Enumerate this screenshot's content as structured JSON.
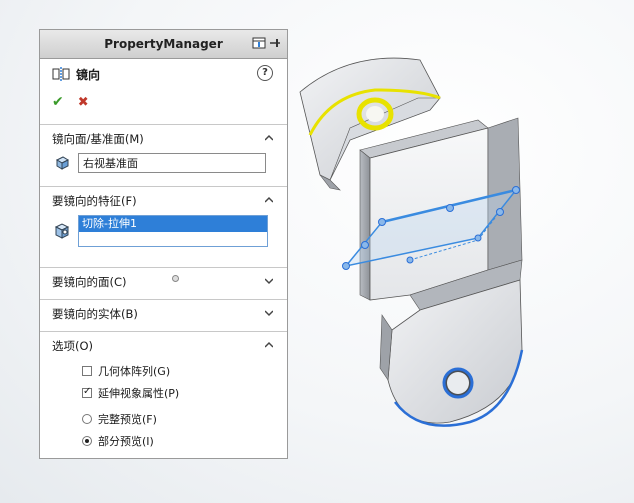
{
  "panel": {
    "header_title": "PropertyManager",
    "feature_title": "镜向",
    "help_label": "?",
    "ok_symbol": "✔",
    "cancel_symbol": "✖"
  },
  "groups": {
    "mirror_plane": {
      "title": "镜向面/基准面(M)",
      "value": "右视基准面"
    },
    "features": {
      "title": "要镜向的特征(F)",
      "items": [
        "切除-拉伸1"
      ]
    },
    "faces": {
      "title": "要镜向的面(C)"
    },
    "bodies": {
      "title": "要镜向的实体(B)"
    },
    "options": {
      "title": "选项(O)",
      "geometry_pattern": {
        "label": "几何体阵列(G)",
        "checked": false
      },
      "propagate_visual": {
        "label": "延伸视象属性(P)",
        "checked": true
      },
      "full_preview": {
        "label": "完整预览(F)",
        "selected": false
      },
      "partial_preview": {
        "label": "部分预览(I)",
        "selected": true
      }
    }
  },
  "colors": {
    "accent": "#2e7fd8",
    "selection_highlight": "#f0e000",
    "preview_blue": "#3a8be0",
    "ok_green": "#3a9b2a",
    "cancel_red": "#c0392b"
  }
}
